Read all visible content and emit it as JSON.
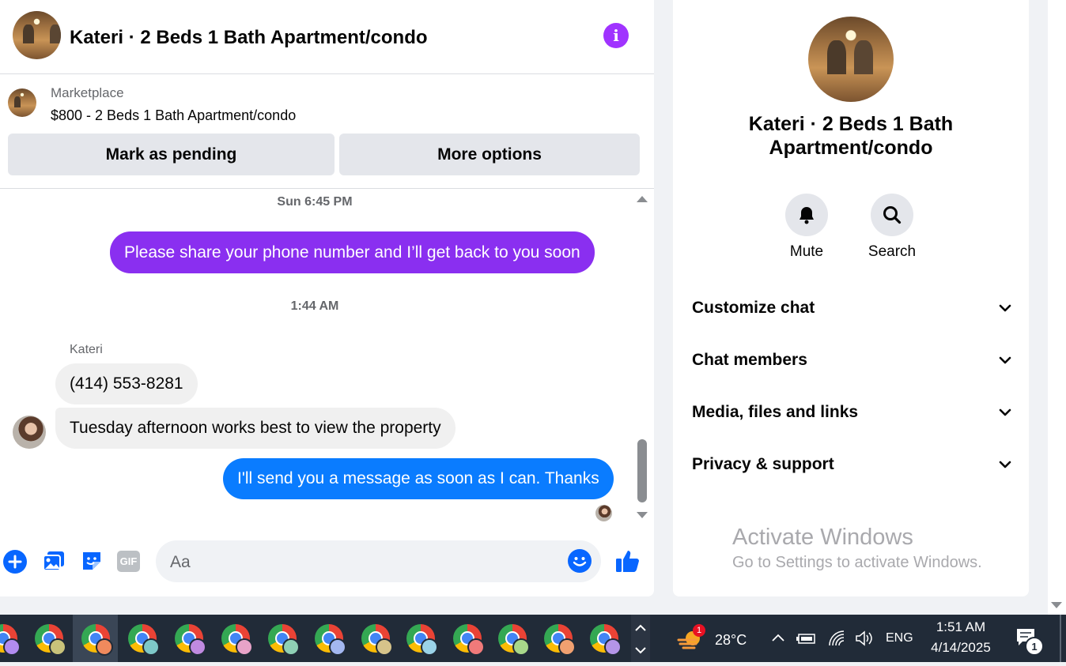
{
  "chat": {
    "header_title": "Kateri · 2 Beds 1 Bath Apartment/condo",
    "marketplace_label": "Marketplace",
    "listing_price_title": "$800 - 2 Beds 1 Bath Apartment/condo",
    "mark_pending_label": "Mark as pending",
    "more_options_label": "More options",
    "timestamp_1": "Sun 6:45 PM",
    "timestamp_2": "1:44 AM",
    "sender_name": "Kateri",
    "messages": [
      {
        "direction": "outgoing",
        "text": "Please share your phone number and I’ll get back to you soon"
      },
      {
        "direction": "incoming",
        "text": "(414) 553-8281"
      },
      {
        "direction": "incoming",
        "text": "Tuesday afternoon works best to view the property"
      },
      {
        "direction": "outgoing",
        "text": "I'll send you a message as soon as I can. Thanks"
      }
    ],
    "composer_placeholder": "Aa"
  },
  "info_panel": {
    "title": "Kateri · 2 Beds 1 Bath Apartment/condo",
    "mute_label": "Mute",
    "search_label": "Search",
    "sections": [
      "Customize chat",
      "Chat members",
      "Media, files and links",
      "Privacy & support"
    ]
  },
  "watermark": {
    "title": "Activate Windows",
    "subtitle": "Go to Settings to activate Windows."
  },
  "taskbar": {
    "weather_badge": "1",
    "temperature": "28°C",
    "language": "ENG",
    "time": "1:51 AM",
    "date": "4/14/2025",
    "notification_count": "1"
  },
  "colors": {
    "accent_purple": "#a033ff",
    "bubble_purple": "#8a2ff0",
    "bubble_blue": "#0a7cff",
    "messenger_blue": "#0866ff"
  }
}
